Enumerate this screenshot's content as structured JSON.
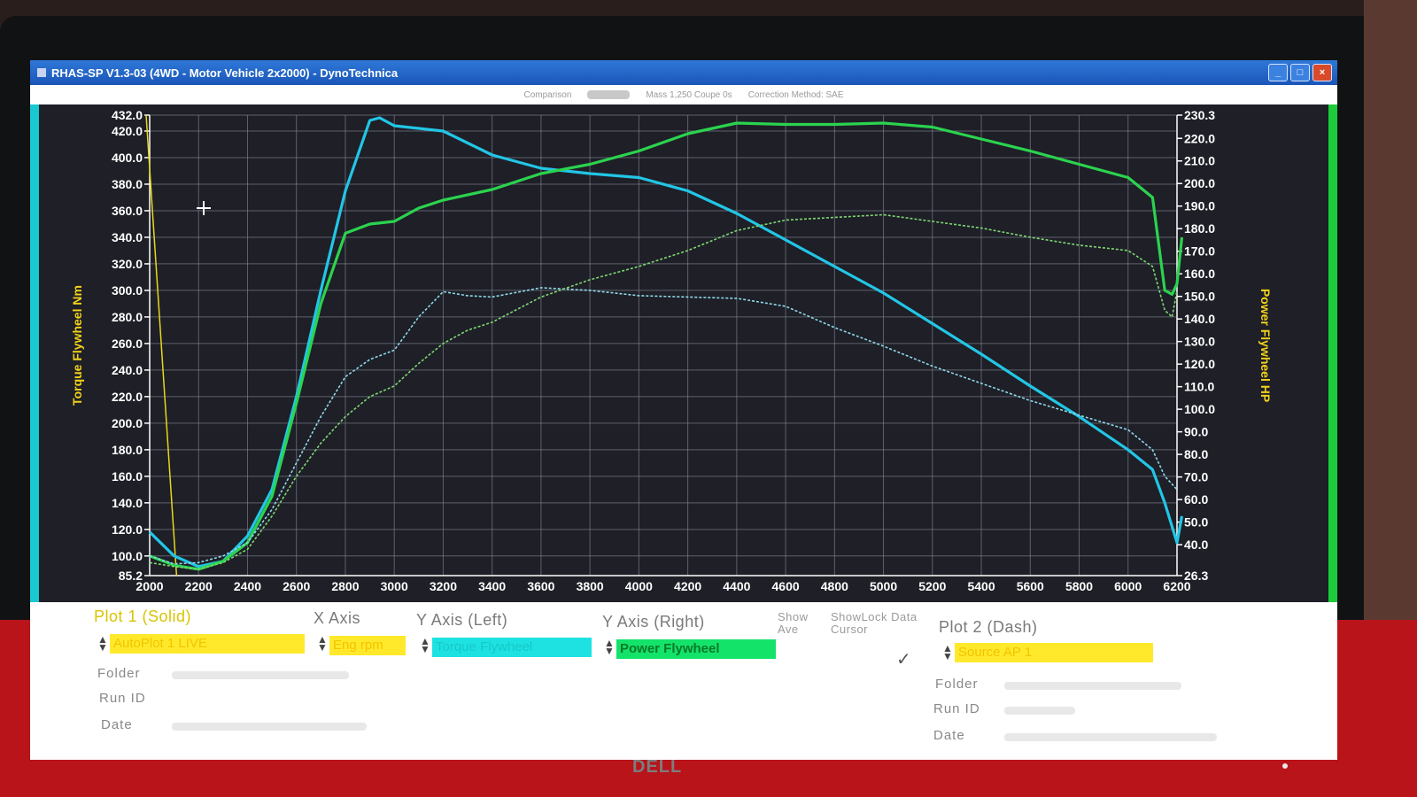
{
  "window": {
    "title": "RHAS-SP V1.3-03  (4WD - Motor Vehicle 2x2000) - DynoTechnica",
    "buttons": [
      "_",
      "□",
      "×"
    ]
  },
  "info_bar": {
    "comparison": "Comparison",
    "mass": "Mass 1,250 Coupe 0s",
    "correction": "Correction Method: SAE"
  },
  "chart_data": {
    "type": "line",
    "xlim": [
      2000,
      6200
    ],
    "x_ticks": [
      2000,
      2200,
      2400,
      2600,
      2800,
      3000,
      3200,
      3400,
      3600,
      3800,
      4000,
      4200,
      4400,
      4600,
      4800,
      5000,
      5200,
      5400,
      5600,
      5800,
      6000,
      6200
    ],
    "left_axis": {
      "label": "Torque Flywheel Nm",
      "ylim": [
        85.2,
        432.0
      ],
      "ticks": [
        85.2,
        100.0,
        120.0,
        140.0,
        160.0,
        180.0,
        200.0,
        220.0,
        240.0,
        260.0,
        280.0,
        300.0,
        320.0,
        340.0,
        360.0,
        380.0,
        400.0,
        420.0,
        432.0
      ]
    },
    "right_axis": {
      "label": "Power Flywheel HP",
      "ylim": [
        26.3,
        230.3
      ],
      "ticks": [
        26.3,
        40.0,
        50.0,
        60.0,
        70.0,
        80.0,
        90.0,
        100.0,
        110.0,
        120.0,
        130.0,
        140.0,
        150.0,
        160.0,
        170.0,
        180.0,
        190.0,
        200.0,
        210.0,
        220.0,
        230.3
      ]
    },
    "cursor_rpm": 2110,
    "series": [
      {
        "key": "torque_plot1",
        "color": "#22c6e6",
        "style": "solid",
        "axis": "left",
        "x": [
          2000,
          2100,
          2200,
          2300,
          2400,
          2500,
          2600,
          2700,
          2800,
          2900,
          2940,
          3000,
          3100,
          3200,
          3400,
          3600,
          3800,
          4000,
          4200,
          4400,
          4600,
          4800,
          5000,
          5200,
          5400,
          5600,
          5800,
          6000,
          6100,
          6150,
          6200,
          6220
        ],
        "y": [
          118,
          100,
          92,
          96,
          115,
          150,
          220,
          300,
          375,
          428,
          430,
          424,
          422,
          420,
          402,
          392,
          388,
          385,
          375,
          358,
          338,
          318,
          298,
          275,
          252,
          228,
          205,
          180,
          165,
          140,
          110,
          130
        ]
      },
      {
        "key": "power_plot1",
        "color": "#2bd34e",
        "style": "solid",
        "axis": "left",
        "x": [
          2000,
          2100,
          2200,
          2300,
          2400,
          2500,
          2600,
          2700,
          2800,
          2900,
          3000,
          3100,
          3200,
          3400,
          3600,
          3800,
          4000,
          4200,
          4400,
          4600,
          4800,
          5000,
          5200,
          5400,
          5600,
          5800,
          6000,
          6100,
          6150,
          6180,
          6200,
          6220
        ],
        "y": [
          100,
          93,
          90,
          96,
          110,
          145,
          215,
          290,
          343,
          350,
          352,
          362,
          368,
          376,
          388,
          395,
          405,
          418,
          426,
          425,
          425,
          426,
          423,
          414,
          405,
          395,
          385,
          370,
          300,
          297,
          305,
          340
        ]
      },
      {
        "key": "torque_plot2",
        "color": "#8fd8ea",
        "style": "dash",
        "axis": "left",
        "x": [
          2000,
          2100,
          2200,
          2300,
          2400,
          2500,
          2600,
          2700,
          2800,
          2900,
          3000,
          3100,
          3200,
          3300,
          3400,
          3600,
          3800,
          4000,
          4200,
          4400,
          4600,
          4800,
          5000,
          5200,
          5400,
          5600,
          5800,
          6000,
          6100,
          6150,
          6200
        ],
        "y": [
          100,
          94,
          95,
          100,
          110,
          135,
          170,
          205,
          235,
          248,
          255,
          280,
          299,
          296,
          295,
          302,
          300,
          296,
          295,
          294,
          288,
          272,
          258,
          243,
          230,
          217,
          206,
          195,
          180,
          160,
          150
        ]
      },
      {
        "key": "power_plot2",
        "color": "#7fd872",
        "style": "dash",
        "axis": "left",
        "x": [
          2000,
          2100,
          2200,
          2300,
          2400,
          2500,
          2600,
          2700,
          2800,
          2900,
          3000,
          3100,
          3200,
          3300,
          3400,
          3600,
          3800,
          4000,
          4200,
          4400,
          4600,
          4800,
          5000,
          5200,
          5400,
          5600,
          5800,
          6000,
          6100,
          6150,
          6180,
          6200
        ],
        "y": [
          95,
          92,
          90,
          95,
          105,
          130,
          160,
          185,
          205,
          220,
          228,
          245,
          260,
          270,
          276,
          295,
          308,
          318,
          330,
          345,
          353,
          355,
          357,
          352,
          347,
          340,
          334,
          330,
          318,
          285,
          280,
          300
        ]
      }
    ]
  },
  "controls": {
    "plot1_header": "Plot 1 (Solid)",
    "xaxis_header": "X Axis",
    "yleft_header": "Y Axis (Left)",
    "yright_header": "Y Axis (Right)",
    "show_ave": "Show Ave",
    "show_lock": "ShowLock Data Cursor",
    "plot2_header": "Plot 2 (Dash)",
    "plot1_source": "AutoPlot 1 LIVE",
    "xaxis_value": "Eng rpm",
    "yleft_value": "Torque Flywheel",
    "yright_value": "Power Flywheel",
    "plot2_source": "Source AP 1",
    "folder_label": "Folder",
    "runid_label": "Run ID",
    "date_label": "Date",
    "check_mark": "✓"
  },
  "monitor_brand": "DELL"
}
